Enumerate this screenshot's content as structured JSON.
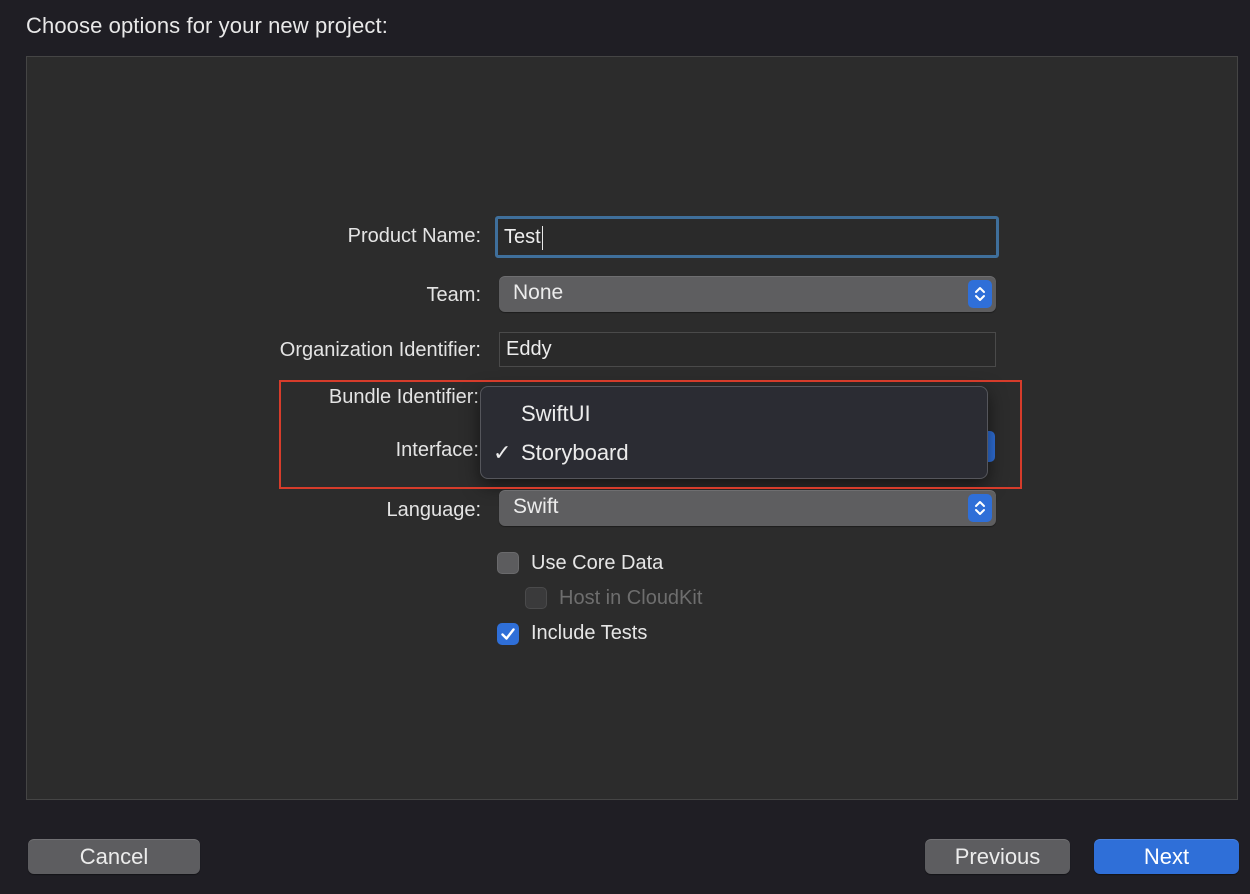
{
  "heading": "Choose options for your new project:",
  "form": {
    "product_name": {
      "label": "Product Name:",
      "value": "Test"
    },
    "team": {
      "label": "Team:",
      "value": "None"
    },
    "organization_identifier": {
      "label": "Organization Identifier:",
      "value": "Eddy"
    },
    "bundle_identifier": {
      "label": "Bundle Identifier:"
    },
    "interface": {
      "label": "Interface:",
      "menu_items": [
        {
          "label": "SwiftUI",
          "selected": false
        },
        {
          "label": "Storyboard",
          "selected": true
        }
      ],
      "checkmark": "✓"
    },
    "language": {
      "label": "Language:",
      "value": "Swift"
    },
    "checkboxes": {
      "use_core_data": {
        "label": "Use Core Data",
        "checked": false
      },
      "host_in_cloudkit": {
        "label": "Host in CloudKit",
        "checked": false,
        "disabled": true
      },
      "include_tests": {
        "label": "Include Tests",
        "checked": true
      }
    }
  },
  "buttons": {
    "cancel": "Cancel",
    "previous": "Previous",
    "next": "Next"
  },
  "colors": {
    "accent": "#2f6fd8",
    "highlight": "#d63c2b",
    "focus_ring": "#3f6f9b"
  },
  "icons": {
    "stepper": "chevron-up-down-icon",
    "check": "checkmark-icon"
  }
}
